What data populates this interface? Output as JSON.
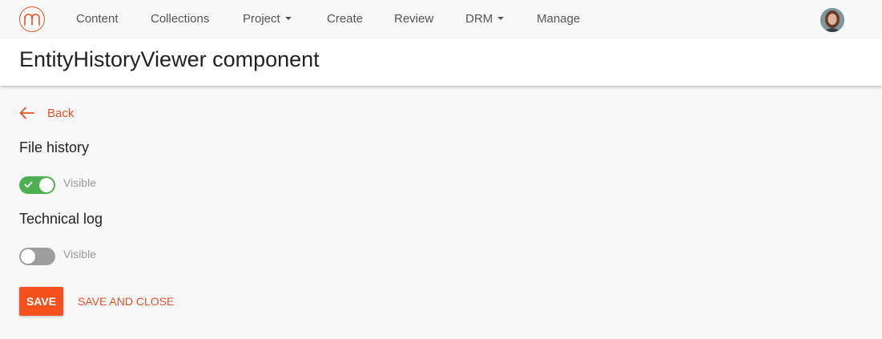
{
  "nav": {
    "items": [
      {
        "label": "Content"
      },
      {
        "label": "Collections"
      },
      {
        "label": "Project"
      },
      {
        "label": "Create"
      },
      {
        "label": "Review"
      },
      {
        "label": "DRM"
      },
      {
        "label": "Manage"
      }
    ],
    "logo_icon": "m-logo-icon",
    "avatar_icon": "user-avatar"
  },
  "header": {
    "title": "EntityHistoryViewer component"
  },
  "back": {
    "label": "Back",
    "icon": "arrow-left-icon"
  },
  "sections": [
    {
      "heading": "File history",
      "toggle_label": "Visible",
      "toggle_on": true
    },
    {
      "heading": "Technical log",
      "toggle_label": "Visible",
      "toggle_on": false
    }
  ],
  "actions": {
    "save_label": "SAVE",
    "save_close_label": "SAVE AND CLOSE"
  },
  "colors": {
    "accent": "#f4511e",
    "link": "#e2522a",
    "toggle_on": "#4caf50",
    "toggle_off": "#9e9e9e"
  }
}
